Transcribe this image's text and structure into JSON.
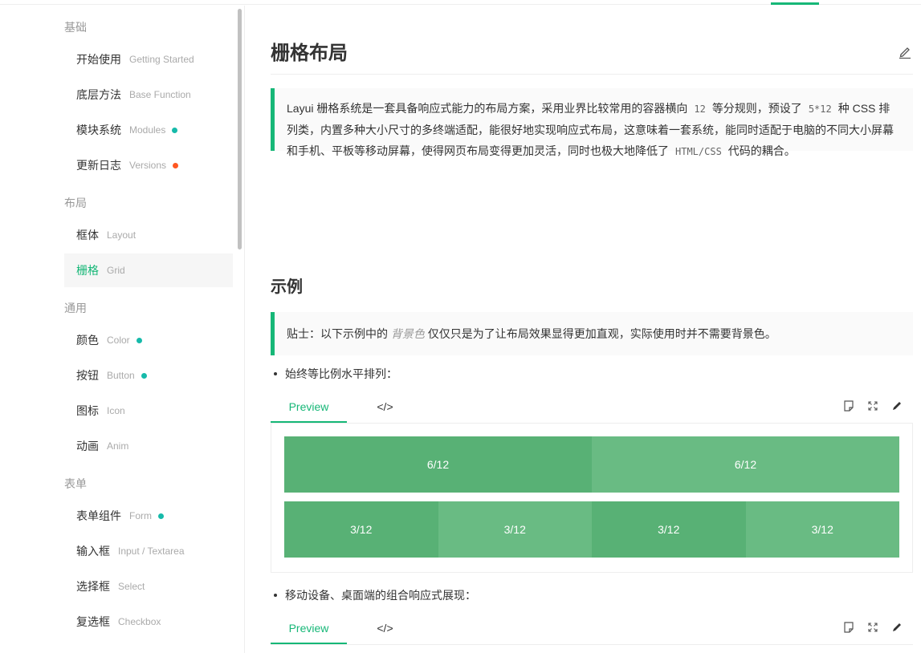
{
  "sidebar": {
    "groups": [
      {
        "title": "基础",
        "items": [
          {
            "zh": "开始使用",
            "en": "Getting Started"
          },
          {
            "zh": "底层方法",
            "en": "Base Function"
          },
          {
            "zh": "模块系统",
            "en": "Modules",
            "dot": "#16baaa"
          },
          {
            "zh": "更新日志",
            "en": "Versions",
            "dot": "#ff5722"
          }
        ]
      },
      {
        "title": "布局",
        "items": [
          {
            "zh": "框体",
            "en": "Layout"
          },
          {
            "zh": "栅格",
            "en": "Grid",
            "active": true
          }
        ]
      },
      {
        "title": "通用",
        "items": [
          {
            "zh": "颜色",
            "en": "Color",
            "dot": "#16baaa"
          },
          {
            "zh": "按钮",
            "en": "Button",
            "dot": "#16baaa"
          },
          {
            "zh": "图标",
            "en": "Icon"
          },
          {
            "zh": "动画",
            "en": "Anim"
          }
        ]
      },
      {
        "title": "表单",
        "items": [
          {
            "zh": "表单组件",
            "en": "Form",
            "dot": "#16baaa"
          },
          {
            "zh": "输入框",
            "en": "Input / Textarea"
          },
          {
            "zh": "选择框",
            "en": "Select"
          },
          {
            "zh": "复选框",
            "en": "Checkbox"
          }
        ]
      }
    ]
  },
  "main": {
    "title": "栅格布局",
    "intro": {
      "part1": "Layui 栅格系统是一套具备响应式能力的布局方案，采用业界比较常用的容器横向",
      "code1": "12",
      "part2": "等分规则，预设了",
      "code2": "5*12",
      "part3": "种 CSS 排列类，内置多种大小尺寸的多终端适配，能很好地实现响应式布局，这意味着一套系统，能同时适配于电脑的不同大小屏幕和手机、平板等移动屏幕，使得网页布局变得更加灵活，同时也极大地降低了",
      "code3": "HTML/CSS",
      "part4": "代码的耦合。"
    },
    "example_title": "示例",
    "tip": {
      "prefix": "贴士：以下示例中的",
      "emph": "背景色",
      "suffix": "仅仅只是为了让布局效果显得更加直观，实际使用时并不需要背景色。"
    },
    "demo1": {
      "bullet": "始终等比例水平排列：",
      "tab_preview": "Preview",
      "tab_code": "</>",
      "row1": [
        "6/12",
        "6/12"
      ],
      "row2": [
        "3/12",
        "3/12",
        "3/12",
        "3/12"
      ]
    },
    "demo2": {
      "bullet": "移动设备、桌面端的组合响应式展现：",
      "tab_preview": "Preview",
      "tab_code": "</>"
    }
  },
  "colors": {
    "accent": "#16b777",
    "cell_dark": "#58b175",
    "cell_light": "#69bb83"
  }
}
